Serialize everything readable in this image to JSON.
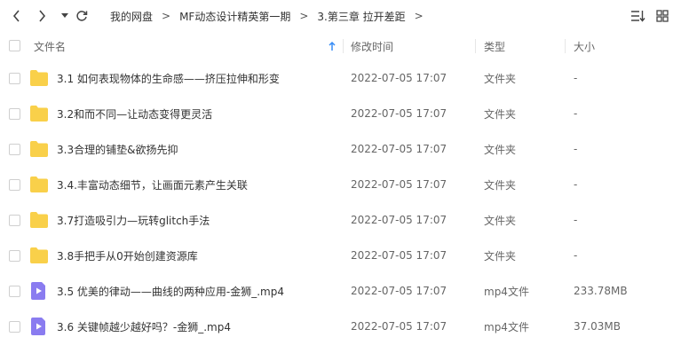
{
  "breadcrumb": [
    "我的网盘",
    "MF动态设计精英第一期",
    "3.第三章 拉开差距"
  ],
  "columns": {
    "name": "文件名",
    "modified": "修改时间",
    "type": "类型",
    "size": "大小"
  },
  "files": [
    {
      "name": "3.1 如何表现物体的生命感——挤压拉伸和形变",
      "modified": "2022-07-05 17:07",
      "type": "文件夹",
      "size": "-",
      "icon": "folder-icon"
    },
    {
      "name": "3.2和而不同—让动态变得更灵活",
      "modified": "2022-07-05 17:07",
      "type": "文件夹",
      "size": "-",
      "icon": "folder-icon"
    },
    {
      "name": "3.3合理的铺垫&欲扬先抑",
      "modified": "2022-07-05 17:07",
      "type": "文件夹",
      "size": "-",
      "icon": "folder-icon"
    },
    {
      "name": "3.4.丰富动态细节，让画面元素产生关联",
      "modified": "2022-07-05 17:07",
      "type": "文件夹",
      "size": "-",
      "icon": "folder-icon"
    },
    {
      "name": "3.7打造吸引力—玩转glitch手法",
      "modified": "2022-07-05 17:07",
      "type": "文件夹",
      "size": "-",
      "icon": "folder-icon"
    },
    {
      "name": "3.8手把手从0开始创建资源库",
      "modified": "2022-07-05 17:07",
      "type": "文件夹",
      "size": "-",
      "icon": "folder-icon"
    },
    {
      "name": "3.5 优美的律动——曲线的两种应用-金狮_.mp4",
      "modified": "2022-07-05 17:07",
      "type": "mp4文件",
      "size": "233.78MB",
      "icon": "video-file-icon"
    },
    {
      "name": "3.6 关键帧越少越好吗？-金狮_.mp4",
      "modified": "2022-07-05 17:07",
      "type": "mp4文件",
      "size": "37.03MB",
      "icon": "video-file-icon"
    }
  ],
  "colors": {
    "folder": "#f9d04a",
    "video": "#8a7cf0",
    "sort_arrow": "#3a8ef6"
  }
}
